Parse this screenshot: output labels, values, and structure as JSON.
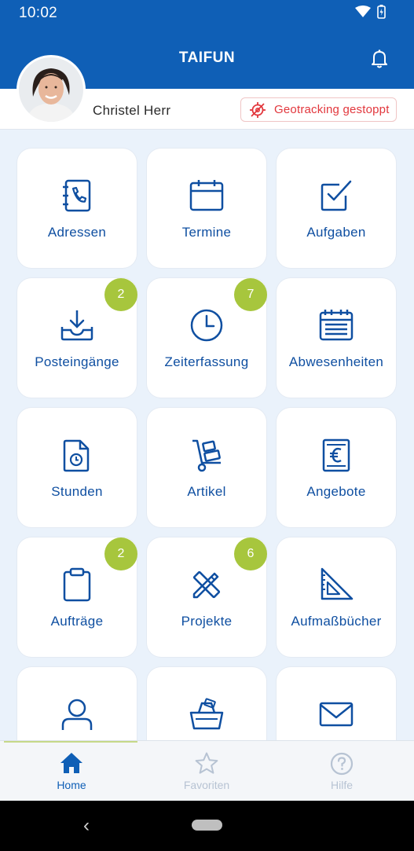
{
  "status": {
    "time": "10:02"
  },
  "app": {
    "title": "TAIFUN"
  },
  "user": {
    "name": "Christel Herr"
  },
  "geotracking": {
    "label": "Geotracking gestoppt",
    "color": "#e2373d"
  },
  "colors": {
    "primary": "#0f5fb6",
    "tile_text": "#0f4fa1",
    "badge": "#a7c63d"
  },
  "tiles": [
    {
      "label": "Adressen",
      "icon": "address-book-icon"
    },
    {
      "label": "Termine",
      "icon": "calendar-icon"
    },
    {
      "label": "Aufgaben",
      "icon": "checkbox-icon"
    },
    {
      "label": "Posteingänge",
      "icon": "inbox-icon",
      "badge": "2"
    },
    {
      "label": "Zeiterfassung",
      "icon": "clock-icon",
      "badge": "7"
    },
    {
      "label": "Abwesenheiten",
      "icon": "calendar-grid-icon"
    },
    {
      "label": "Stunden",
      "icon": "document-clock-icon"
    },
    {
      "label": "Artikel",
      "icon": "hand-truck-icon"
    },
    {
      "label": "Angebote",
      "icon": "euro-document-icon"
    },
    {
      "label": "Aufträge",
      "icon": "clipboard-icon",
      "badge": "2"
    },
    {
      "label": "Projekte",
      "icon": "pencil-ruler-icon",
      "badge": "6"
    },
    {
      "label": "Aufmaßbücher",
      "icon": "set-square-icon"
    },
    {
      "label": "",
      "icon": "person-icon"
    },
    {
      "label": "",
      "icon": "basket-icon"
    },
    {
      "label": "",
      "icon": "envelope-icon"
    }
  ],
  "nav": [
    {
      "label": "Home",
      "icon": "home-icon",
      "active": true
    },
    {
      "label": "Favoriten",
      "icon": "star-icon"
    },
    {
      "label": "Hilfe",
      "icon": "help-icon"
    }
  ]
}
